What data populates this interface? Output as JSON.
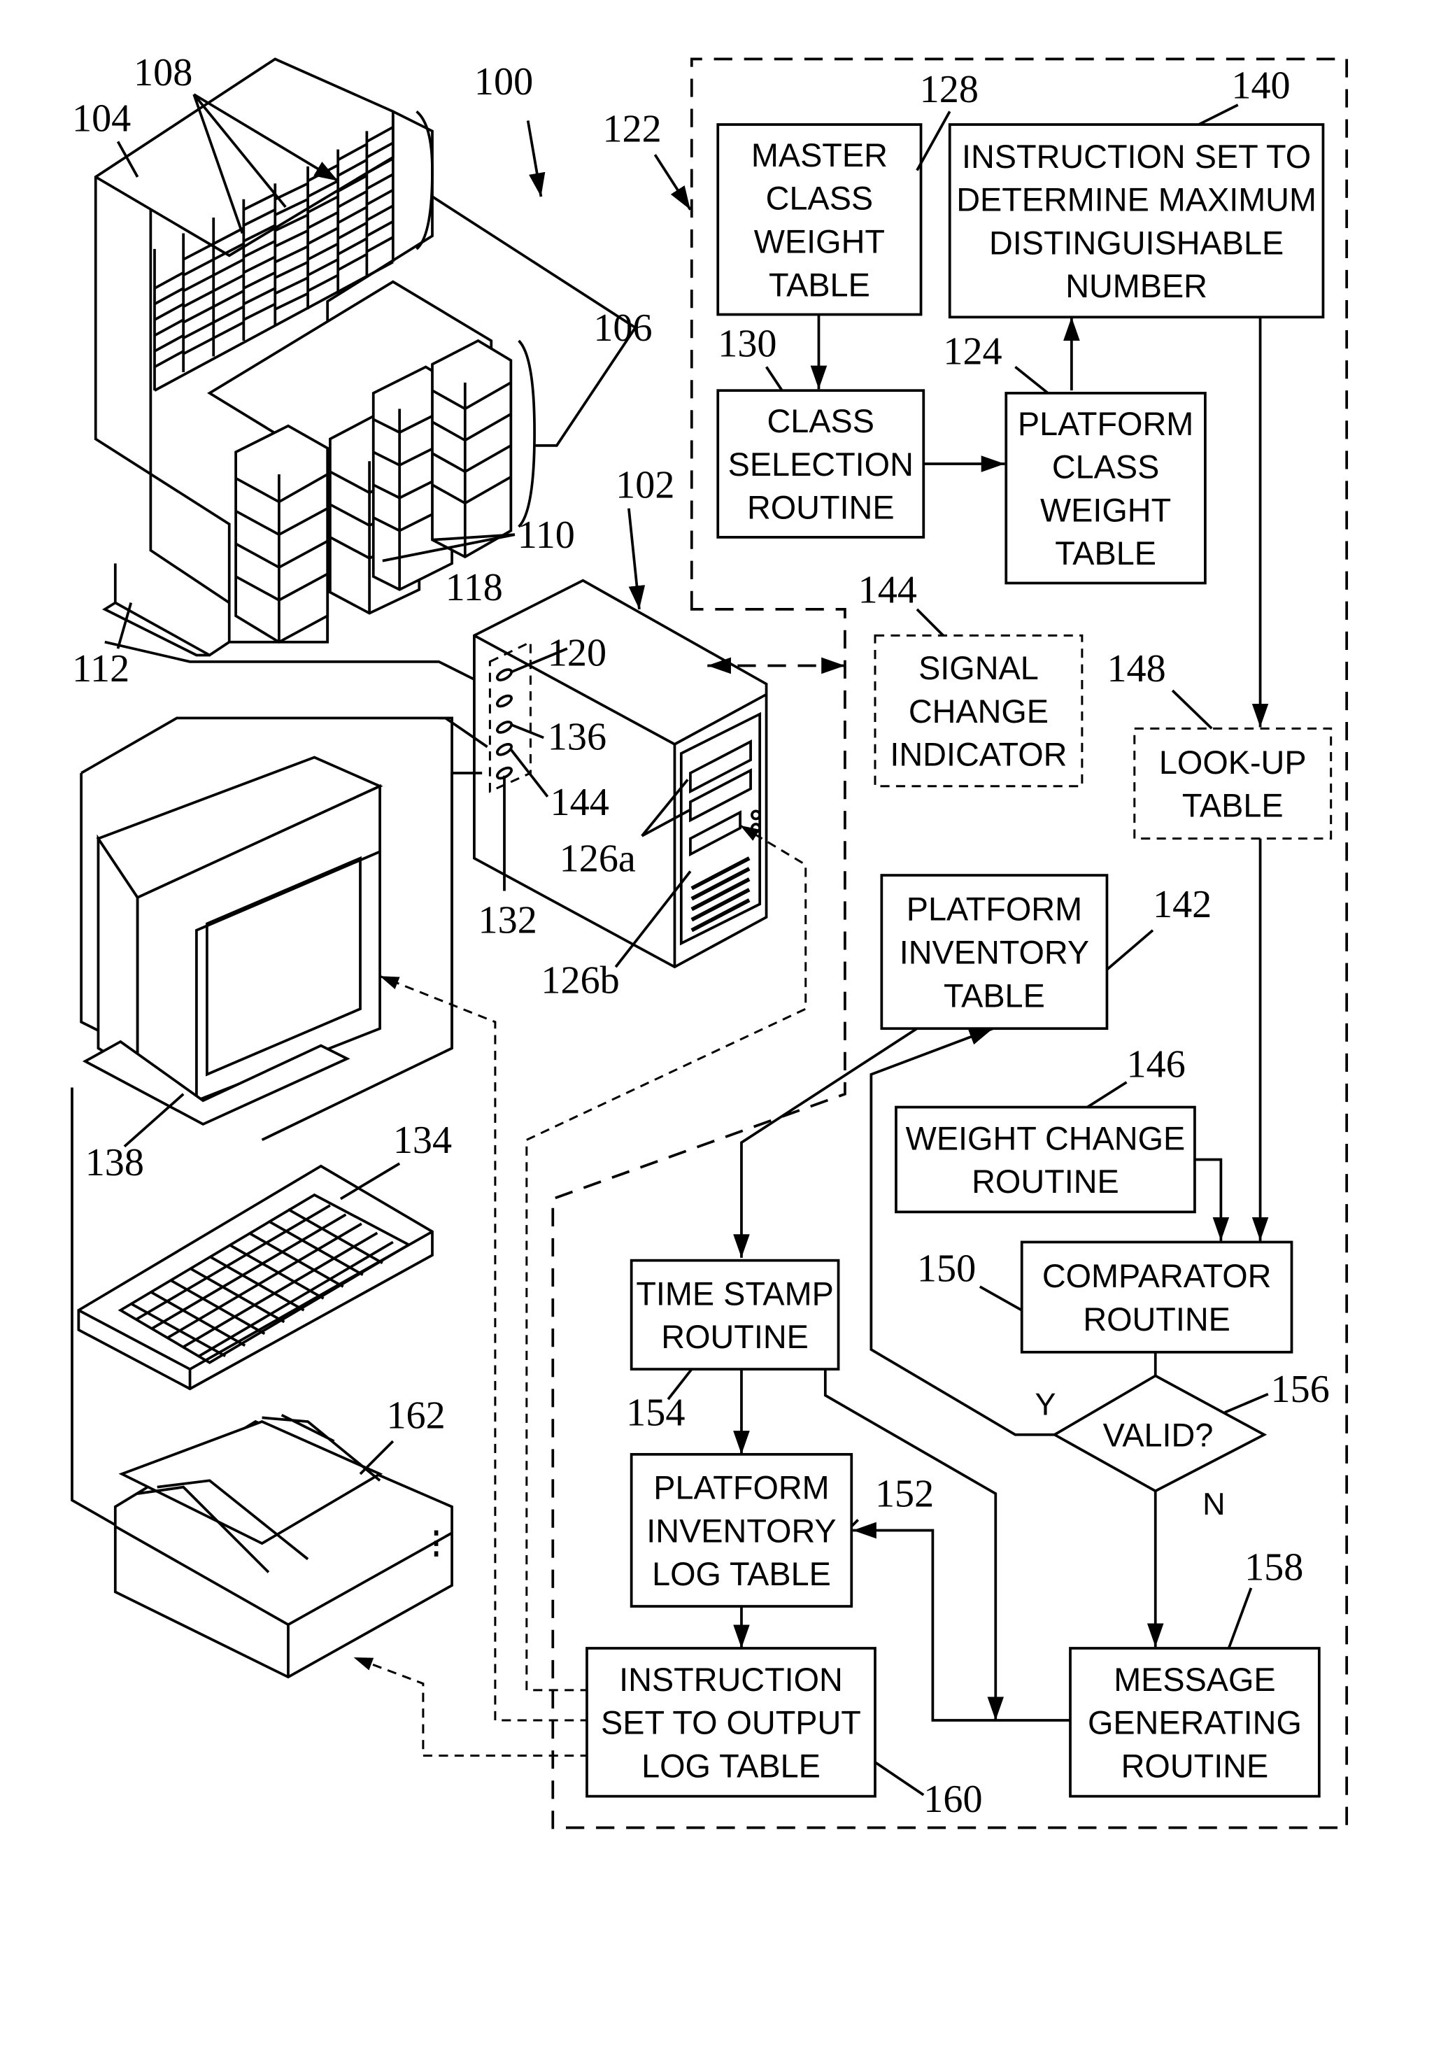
{
  "figure": {
    "system_ref": "100",
    "hardware": {
      "storage_library": {
        "ref": "104",
        "tape_slots_ref": "108",
        "brackets_ref": "106",
        "drives_ref": "110",
        "base_ref": "112"
      },
      "computer": {
        "ref": "102",
        "cable_ref": "118",
        "port_120": "120",
        "port_136": "136",
        "port_144": "144",
        "port_132": "132",
        "drives_a_ref": "126a",
        "drive_b_ref": "126b"
      },
      "monitor_ref": "138",
      "keyboard_ref": "134",
      "printer_ref": "162"
    },
    "software_group_ref": "122",
    "blocks": {
      "master_class_weight_table": {
        "ref": "128",
        "lines": [
          "MASTER",
          "CLASS",
          "WEIGHT",
          "TABLE"
        ]
      },
      "instruction_set_max_number": {
        "ref": "140",
        "lines": [
          "INSTRUCTION SET TO",
          "DETERMINE MAXIMUM",
          "DISTINGUISHABLE",
          "NUMBER"
        ]
      },
      "class_selection_routine": {
        "ref": "130",
        "lines": [
          "CLASS",
          "SELECTION",
          "ROUTINE"
        ]
      },
      "platform_class_weight_table": {
        "ref": "124",
        "lines": [
          "PLATFORM",
          "CLASS",
          "WEIGHT",
          "TABLE"
        ]
      },
      "signal_change_indicator": {
        "ref": "144",
        "lines": [
          "SIGNAL",
          "CHANGE",
          "INDICATOR"
        ]
      },
      "look_up_table": {
        "ref": "148",
        "lines": [
          "LOOK-UP",
          "TABLE"
        ]
      },
      "platform_inventory_table": {
        "ref": "142",
        "lines": [
          "PLATFORM",
          "INVENTORY",
          "TABLE"
        ]
      },
      "weight_change_routine": {
        "ref": "146",
        "lines": [
          "WEIGHT CHANGE",
          "ROUTINE"
        ]
      },
      "comparator_routine": {
        "ref": "150",
        "lines": [
          "COMPARATOR",
          "ROUTINE"
        ]
      },
      "valid_decision": {
        "ref": "156",
        "lines": [
          "VALID?"
        ],
        "yes_label": "Y",
        "no_label": "N"
      },
      "time_stamp_routine": {
        "ref": "154",
        "lines": [
          "TIME STAMP",
          "ROUTINE"
        ]
      },
      "platform_inventory_log_table": {
        "ref": "152",
        "lines": [
          "PLATFORM",
          "INVENTORY",
          "LOG TABLE"
        ]
      },
      "instruction_set_output_log": {
        "ref": "160",
        "lines": [
          "INSTRUCTION",
          "SET TO OUTPUT",
          "LOG TABLE"
        ]
      },
      "message_generating_routine": {
        "ref": "158",
        "lines": [
          "MESSAGE",
          "GENERATING",
          "ROUTINE"
        ]
      }
    }
  }
}
